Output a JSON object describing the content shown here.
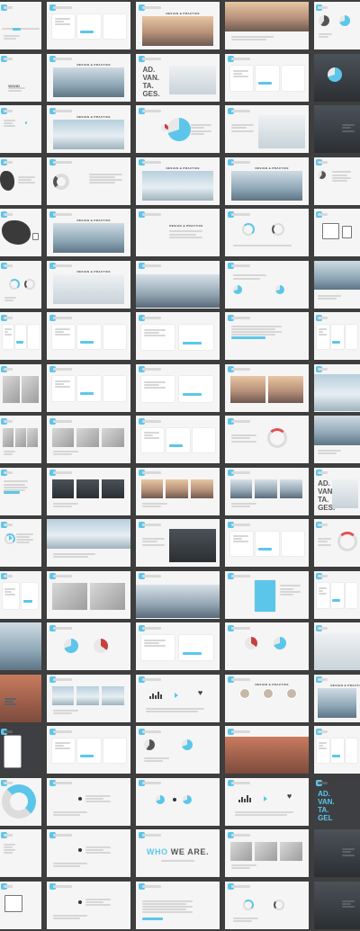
{
  "gallery": {
    "background": "#3e3e3e",
    "slide_background": "#f5f5f5",
    "accent_color": "#5cc6ea",
    "secondary_color": "#c94040",
    "columns": 5,
    "rows": 18
  },
  "text": {
    "design_practice": "DESIGN & PRACTICE",
    "advantages": "AD.\nVAN.\nTA.\nGES.",
    "advantages_short": "AD.\nVAN.\nTA.\nGEL",
    "who": "WHO",
    "we_are": "WE ARE.",
    "wood": "WOOD"
  },
  "slides": [
    {
      "t": "timeline"
    },
    {
      "t": "cards3"
    },
    {
      "t": "photo-title",
      "p": "p-warm"
    },
    {
      "t": "photo-strip",
      "p": "p-warm"
    },
    {
      "t": "pies"
    },
    {
      "t": "text"
    },
    {
      "t": "photo-title",
      "p": "p-mtn"
    },
    {
      "t": "adv"
    },
    {
      "t": "cards3"
    },
    {
      "t": "dark-pie"
    },
    {
      "t": "dots"
    },
    {
      "t": "photo-title",
      "p": "p-sky"
    },
    {
      "t": "pie-chart"
    },
    {
      "t": "photo-person",
      "p": "p-fog"
    },
    {
      "t": "dark-text"
    },
    {
      "t": "map-left"
    },
    {
      "t": "donut-lines"
    },
    {
      "t": "photo-title",
      "p": "p-sky"
    },
    {
      "t": "photo-title",
      "p": "p-mtn"
    },
    {
      "t": "pies-small"
    },
    {
      "t": "map"
    },
    {
      "t": "photo-title",
      "p": "p-mtn"
    },
    {
      "t": "design-text"
    },
    {
      "t": "rings"
    },
    {
      "t": "devices"
    },
    {
      "t": "donuts"
    },
    {
      "t": "photo-title",
      "p": "p-fog"
    },
    {
      "t": "photo-city",
      "p": "p-city"
    },
    {
      "t": "pies-lines"
    },
    {
      "t": "photo-strip",
      "p": "p-mtn"
    },
    {
      "t": "cards3"
    },
    {
      "t": "cards3"
    },
    {
      "t": "cards2"
    },
    {
      "t": "text-cyan"
    },
    {
      "t": "cards3"
    },
    {
      "t": "photo-pair",
      "p": "p-gray"
    },
    {
      "t": "cards3"
    },
    {
      "t": "cards2"
    },
    {
      "t": "photo-pair",
      "p": "p-warm"
    },
    {
      "t": "photo-wide",
      "p": "p-sky"
    },
    {
      "t": "photo-grid",
      "p": "p-gray"
    },
    {
      "t": "photo-grid",
      "p": "p-gray"
    },
    {
      "t": "cards3"
    },
    {
      "t": "ring-red"
    },
    {
      "t": "photo-strip",
      "p": "p-mtn"
    },
    {
      "t": "text-cyan"
    },
    {
      "t": "photo-grid",
      "p": "p-dark"
    },
    {
      "t": "photo-grid",
      "p": "p-warm"
    },
    {
      "t": "photo-grid",
      "p": "p-city"
    },
    {
      "t": "adv"
    },
    {
      "t": "arrow-pie"
    },
    {
      "t": "photo-strip",
      "p": "p-sky"
    },
    {
      "t": "photo-person",
      "p": "p-dark"
    },
    {
      "t": "cards3"
    },
    {
      "t": "ring-red"
    },
    {
      "t": "cards2"
    },
    {
      "t": "photo-pair",
      "p": "p-gray"
    },
    {
      "t": "photo-city",
      "p": "p-city"
    },
    {
      "t": "card-cyan"
    },
    {
      "t": "cards3"
    },
    {
      "t": "photo-mtn",
      "p": "p-mtn"
    },
    {
      "t": "circles"
    },
    {
      "t": "cards2"
    },
    {
      "t": "pie-red"
    },
    {
      "t": "photo-wide",
      "p": "p-fog"
    },
    {
      "t": "dark-photo",
      "p": "p-red"
    },
    {
      "t": "photo-grid",
      "p": "p-sky"
    },
    {
      "t": "icons"
    },
    {
      "t": "people"
    },
    {
      "t": "photo-title",
      "p": "p-mtn"
    },
    {
      "t": "dark-card"
    },
    {
      "t": "cards3"
    },
    {
      "t": "pies"
    },
    {
      "t": "photo-wide",
      "p": "p-red"
    },
    {
      "t": "cards3"
    },
    {
      "t": "big-donut"
    },
    {
      "t": "nodes"
    },
    {
      "t": "nodes-cyan"
    },
    {
      "t": "icons"
    },
    {
      "t": "dark-adv"
    },
    {
      "t": "nodes-left"
    },
    {
      "t": "nodes"
    },
    {
      "t": "who"
    },
    {
      "t": "photo-grid",
      "p": "p-gray"
    },
    {
      "t": "dark-text"
    },
    {
      "t": "laptop"
    },
    {
      "t": "nodes"
    },
    {
      "t": "lines"
    },
    {
      "t": "donuts"
    },
    {
      "t": "dark-text"
    }
  ]
}
